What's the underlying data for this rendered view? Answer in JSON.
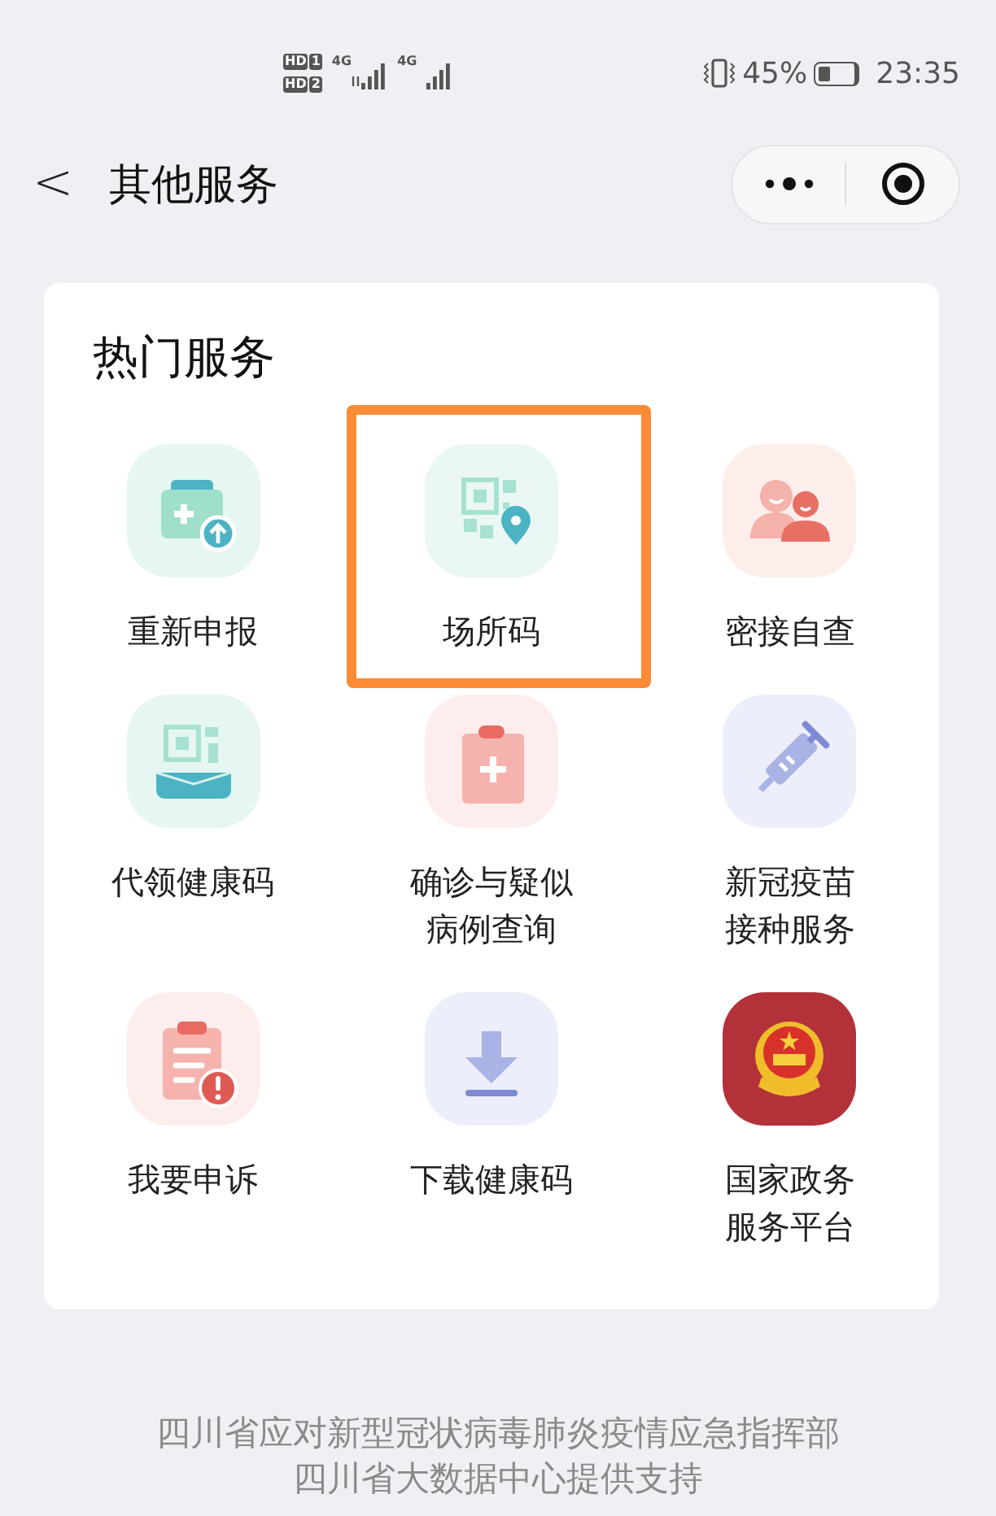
{
  "status_bar": {
    "sims": [
      {
        "badge": "HD",
        "slot": "1"
      },
      {
        "badge": "HD",
        "slot": "2"
      }
    ],
    "networks": [
      "4G",
      "4G"
    ],
    "battery_percent": "45%",
    "battery": {
      "level": 0.45
    },
    "time": "23:35"
  },
  "nav": {
    "back": "<",
    "title": "其他服务"
  },
  "card": {
    "title": "热门服务",
    "items": [
      {
        "label_lines": [
          "重新申报"
        ],
        "highlighted": false
      },
      {
        "label_lines": [
          "场所码"
        ],
        "highlighted": true
      },
      {
        "label_lines": [
          "密接自查"
        ],
        "highlighted": false
      },
      {
        "label_lines": [
          "代领健康码"
        ],
        "highlighted": false
      },
      {
        "label_lines": [
          "确诊与疑似",
          "病例查询"
        ],
        "highlighted": false
      },
      {
        "label_lines": [
          "新冠疫苗",
          "接种服务"
        ],
        "highlighted": false
      },
      {
        "label_lines": [
          "我要申诉"
        ],
        "highlighted": false
      },
      {
        "label_lines": [
          "下载健康码"
        ],
        "highlighted": false
      },
      {
        "label_lines": [
          "国家政务",
          "服务平台"
        ],
        "highlighted": false
      }
    ]
  },
  "footer": [
    "四川省应对新型冠状病毒肺炎疫情应急指挥部",
    "四川省大数据中心提供支持"
  ]
}
